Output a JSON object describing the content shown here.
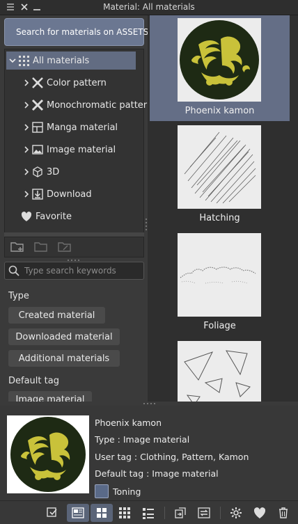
{
  "window": {
    "title": "Material: All materials"
  },
  "assets_button": {
    "label": "Search for materials on ASSETS"
  },
  "tree": [
    {
      "label": "All materials",
      "icon": "grid-dots-icon"
    },
    {
      "label": "Color pattern",
      "icon": "color-pattern-icon"
    },
    {
      "label": "Monochromatic pattern",
      "icon": "mono-pattern-icon"
    },
    {
      "label": "Manga material",
      "icon": "manga-icon"
    },
    {
      "label": "Image material",
      "icon": "image-icon"
    },
    {
      "label": "3D",
      "icon": "cube-icon"
    },
    {
      "label": "Download",
      "icon": "download-icon"
    },
    {
      "label": "Favorite",
      "icon": "heart-icon"
    }
  ],
  "search": {
    "placeholder": "Type search keywords"
  },
  "filter": {
    "type_label": "Type",
    "type_buttons": [
      "Created material",
      "Downloaded material",
      "Additional materials"
    ],
    "default_tag_label": "Default tag",
    "tag_buttons": [
      "Image material"
    ]
  },
  "materials": [
    {
      "name": "Phoenix kamon"
    },
    {
      "name": "Hatching"
    },
    {
      "name": "Foliage"
    },
    {
      "name": ""
    }
  ],
  "detail": {
    "name": "Phoenix kamon",
    "type": "Type : Image material",
    "user_tag": "User tag : Clothing, Pattern, Kamon",
    "default_tag": "Default tag : Image material",
    "toning_label": "Toning"
  },
  "colors": {
    "accent": "#626c82",
    "kamon_dark": "#1e2a14",
    "kamon_gold": "#c9c23a"
  }
}
